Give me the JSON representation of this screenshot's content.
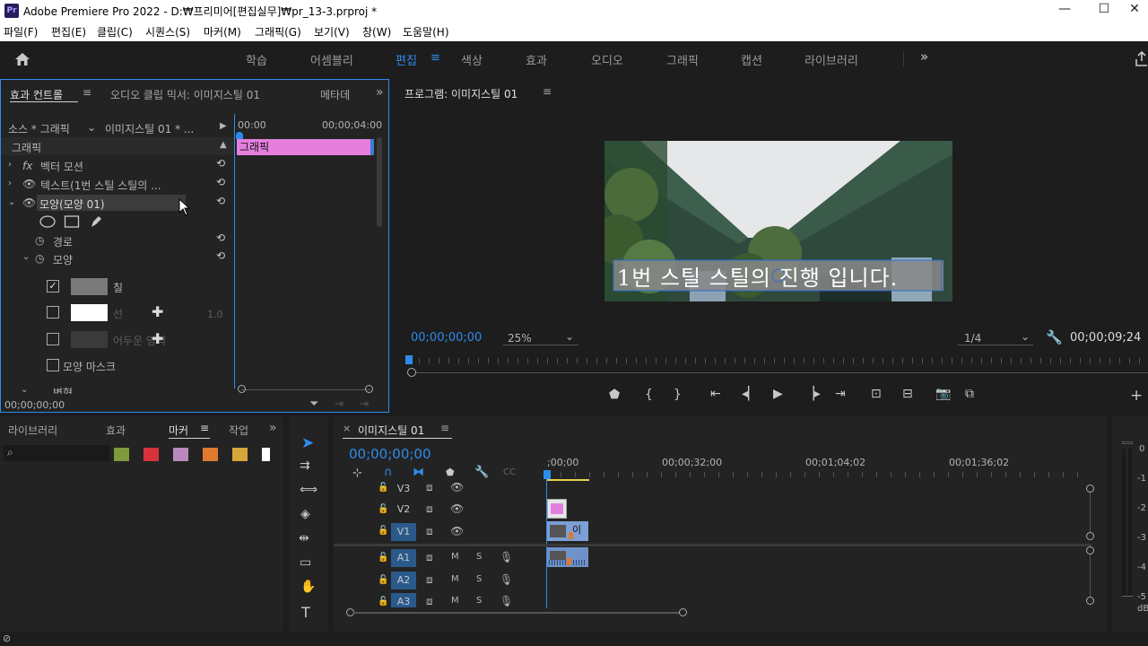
{
  "window": {
    "title": "Adobe Premiere Pro 2022 - D:₩프리미어[편집실무]₩pr_13-3.prproj *",
    "logo": "Pr"
  },
  "menu": [
    "파일(F)",
    "편집(E)",
    "클립(C)",
    "시퀀스(S)",
    "마커(M)",
    "그래픽(G)",
    "보기(V)",
    "창(W)",
    "도움말(H)"
  ],
  "workspaces": [
    "학습",
    "어셈블리",
    "편집",
    "색상",
    "효과",
    "오디오",
    "그래픽",
    "캡션",
    "라이브러리"
  ],
  "effect_controls": {
    "tabs": [
      "효과 컨트롤",
      "오디오 클립 믹서: 이미지스틸 01",
      "메타데"
    ],
    "source": "소스 * 그래픽",
    "sequence": "이미지스틸 01 * ...",
    "time_start": "00:00",
    "time_end": "00;00;04:00",
    "section": "그래픽",
    "graphic_clip": "그래픽",
    "rows": [
      "벡터 모션",
      "텍스트(1번 스틸 스틸의 ...",
      "모양(모양 01)",
      "경로",
      "모양",
      "칠",
      "선",
      "어두운 영역",
      "모양 마스크",
      "변형"
    ],
    "stroke_width": "1.0",
    "timecode": "00;00;00;00"
  },
  "program": {
    "title": "프로그램: 이미지스틸 01",
    "caption": "1번 스틸 스틸의 진행 입니다.",
    "timecode": "00;00;00;00",
    "zoom": "25%",
    "resolution": "1/4",
    "duration": "00;00;09;24"
  },
  "project_panel": {
    "tabs": [
      "라이브러리",
      "효과",
      "마커",
      "작업"
    ],
    "swatch_colors": [
      "#7f9a3c",
      "#d8333c",
      "#b989bd",
      "#e07a2e",
      "#d8a53a",
      "#ffffff"
    ]
  },
  "timeline": {
    "title": "이미지스틸 01",
    "timecode": "00;00;00;00",
    "ruler": [
      ";00;00",
      "00;00;32;00",
      "00;01;04;02",
      "00;01;36;02"
    ],
    "video_tracks": [
      "V3",
      "V2",
      "V1"
    ],
    "audio_tracks": [
      "A1",
      "A2",
      "A3"
    ],
    "clip_label": "이",
    "track_btn_m": "M",
    "track_btn_s": "S"
  },
  "meter": {
    "scale": [
      "0",
      "-1",
      "-2",
      "-3",
      "-4",
      "-5"
    ],
    "unit": "dB"
  },
  "colors": {
    "accent": "#2d8ceb",
    "graphic_clip": "#e47fde",
    "video_clip": "#7b9fd6",
    "audio_clip": "#6f92c8"
  }
}
